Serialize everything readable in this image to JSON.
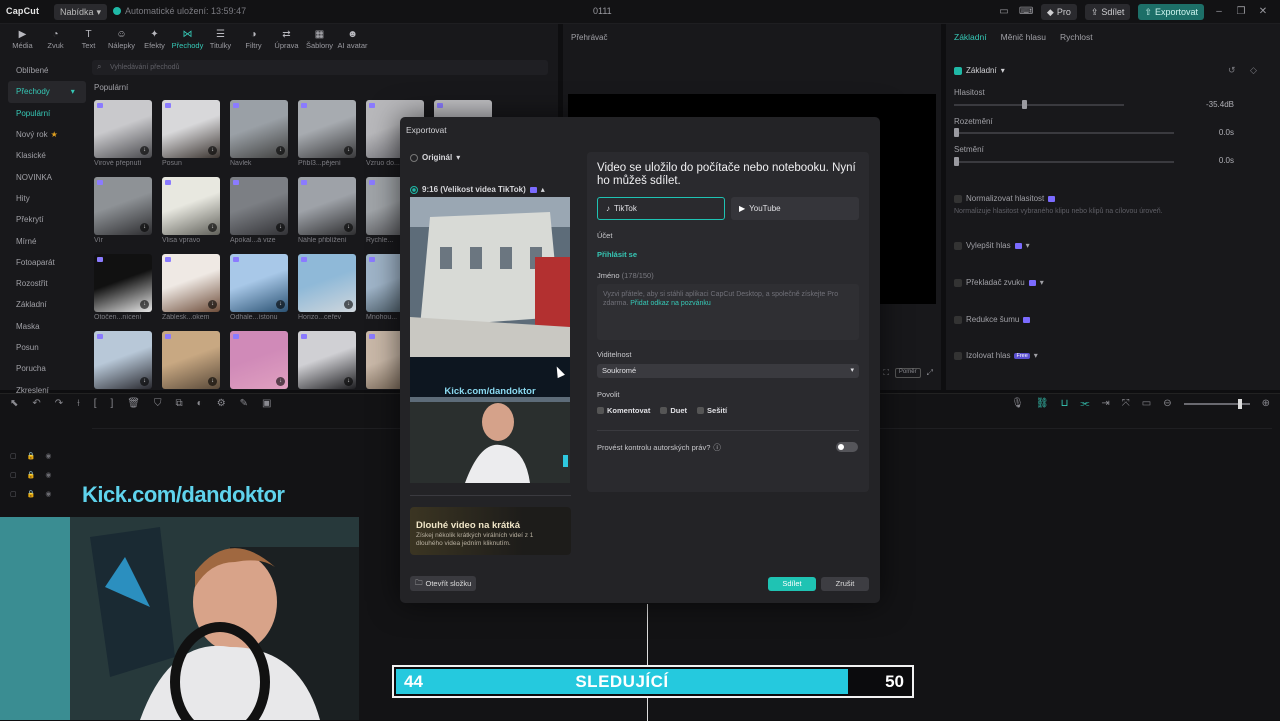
{
  "titlebar": {
    "logo": "CapCut",
    "menu_label": "Nabídka",
    "autosave": "Automatické uložení: 13:59:47",
    "project": "0111",
    "pro_label": "Pro",
    "share_label": "Sdílet",
    "export_label": "Exportovat"
  },
  "toolbar": [
    {
      "label": "Média",
      "icon": "media-icon"
    },
    {
      "label": "Zvuk",
      "icon": "audio-icon"
    },
    {
      "label": "Text",
      "icon": "text-icon"
    },
    {
      "label": "Nálepky",
      "icon": "sticker-icon"
    },
    {
      "label": "Efekty",
      "icon": "effects-icon"
    },
    {
      "label": "Přechody",
      "icon": "transitions-icon"
    },
    {
      "label": "Titulky",
      "icon": "captions-icon"
    },
    {
      "label": "Filtry",
      "icon": "filters-icon"
    },
    {
      "label": "Úprava",
      "icon": "adjust-icon"
    },
    {
      "label": "Šablony",
      "icon": "templates-icon"
    },
    {
      "label": "AI avatar",
      "icon": "ai-avatar-icon"
    }
  ],
  "sidebar": [
    "Oblíbené",
    "Přechody",
    "Populární",
    "Nový rok",
    "Klasické",
    "NOVINKA",
    "Hity",
    "Překrytí",
    "Mírné",
    "Fotoaparát",
    "Rozostřit",
    "Základní",
    "Maska",
    "Posun",
    "Porucha",
    "Zkreslení"
  ],
  "search_placeholder": "Vyhledávání přechodů",
  "grid_title": "Populární",
  "grid_labels": [
    "Virové přepnutí",
    "Posun",
    "Navlek",
    "Přibl3...pějení",
    "Vzruo do...",
    "",
    "Vír",
    "Vlisa vpravo",
    "Apokal...á vize",
    "Náhle přiblížení",
    "Rychle...",
    "",
    "Otočen...nícení",
    "Záblesk...okem",
    "Odhale...ístonu",
    "Horizo...ceřev",
    "Mnohou...",
    "",
    "",
    "",
    "",
    "",
    "",
    ""
  ],
  "player": {
    "title": "Přehrávač",
    "ratio": "Poměr"
  },
  "right": {
    "tabs": [
      "Základní",
      "Měnič hlasu",
      "Rychlost"
    ],
    "section": "Základní",
    "volume_label": "Hlasitost",
    "volume_value": "-35.4dB",
    "fadein_label": "Rozetmění",
    "fadein_value": "0.0s",
    "fadeout_label": "Setmění",
    "fadeout_value": "0.0s",
    "normalize_label": "Normalizovat hlasitost",
    "normalize_desc": "Normalizuje hlasitost vybraného klipu nebo klipů na cílovou úroveň.",
    "enhance_label": "Vylepšit hlas",
    "translate_label": "Překladač zvuku",
    "noise_label": "Redukce šumu",
    "isolate_label": "Izolovat hlas",
    "isolate_badge": "Free"
  },
  "overlay": {
    "kick_text": "Kick.com/dandoktor",
    "followers_current": "44",
    "followers_title": "SLEDUJÍCÍ",
    "followers_goal": "50",
    "followers_progress": 0.88
  },
  "dialog": {
    "title": "Exportovat",
    "opt_original": "Originál",
    "opt_916": "9:16 (Velikost videa TikTok)",
    "preview_kick": "Kick.com/dandoktor",
    "promo_title": "Dlouhé video na krátká",
    "promo_desc": "Získej několik krátkých virálních videí z 1 dlouhého videa jedním kliknutím.",
    "open_folder": "Otevřít složku",
    "share_btn": "Sdílet",
    "cancel_btn": "Zrušit",
    "card": {
      "headline": "Video se uložilo do počítače nebo notebooku. Nyní ho můžeš sdílet.",
      "platform_tiktok": "TikTok",
      "platform_youtube": "YouTube",
      "account_label": "Účet",
      "login_link": "Přihlásit se",
      "name_label": "Jméno",
      "name_count": "(178/150)",
      "name_text": "Vyzvi přátele, aby si stáhli aplikaci CapCut Desktop, a společně získejte Pro zdarma.",
      "name_link": "Přidat odkaz na pozvánku",
      "visibility_label": "Viditelnost",
      "visibility_value": "Soukromé",
      "allow_label": "Povolit",
      "allow_comment": "Komentovat",
      "allow_duet": "Duet",
      "allow_stitch": "Sešití",
      "copyright_label": "Provést kontrolu autorských práv?"
    }
  }
}
